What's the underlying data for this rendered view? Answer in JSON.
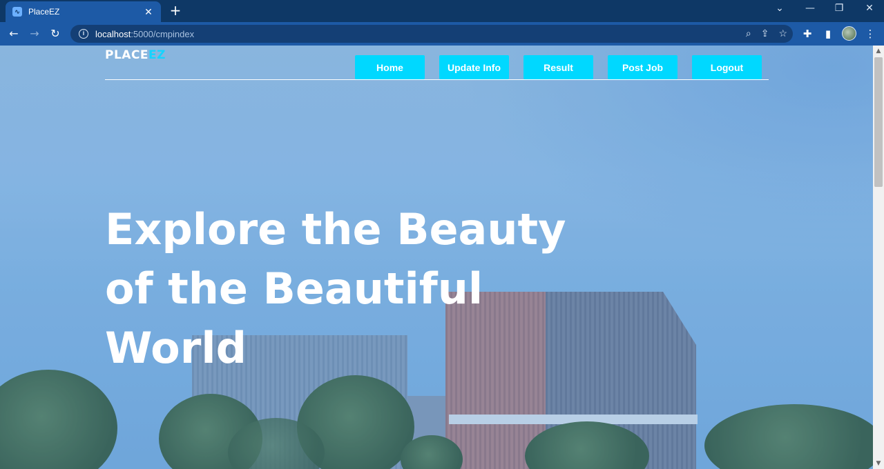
{
  "browser": {
    "tab_title": "PlaceEZ",
    "tab_close": "✕",
    "new_tab": "+",
    "url_host": "localhost",
    "url_path": ":5000/cmpindex",
    "window_controls": [
      "⌄",
      "—",
      "❐",
      "✕"
    ]
  },
  "site": {
    "logo_part1": "PLACE",
    "logo_part2": "EZ",
    "nav": [
      "Home",
      "Update Info",
      "Result",
      "Post Job",
      "Logout"
    ],
    "hero_title": "Explore the Beauty of the Beautiful World"
  },
  "colors": {
    "accent": "#00d8ff",
    "logo_accent": "#15d4ff",
    "browser_frame": "#1d5aa6"
  }
}
